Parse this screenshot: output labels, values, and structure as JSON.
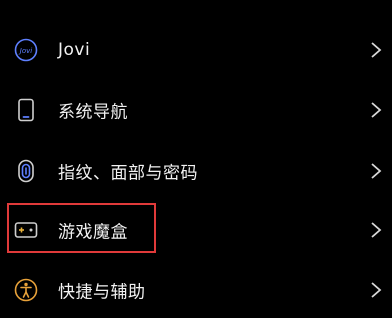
{
  "items": [
    {
      "label": "Jovi",
      "icon": "jovi-icon"
    },
    {
      "label": "系统导航",
      "icon": "phone-navigation-icon"
    },
    {
      "label": "指纹、面部与密码",
      "icon": "fingerprint-icon"
    },
    {
      "label": "游戏魔盒",
      "icon": "game-box-icon"
    },
    {
      "label": "快捷与辅助",
      "icon": "accessibility-icon"
    }
  ],
  "colors": {
    "background": "#000000",
    "icon_accent": "#5f80ff",
    "highlight": "#e03a3a"
  }
}
